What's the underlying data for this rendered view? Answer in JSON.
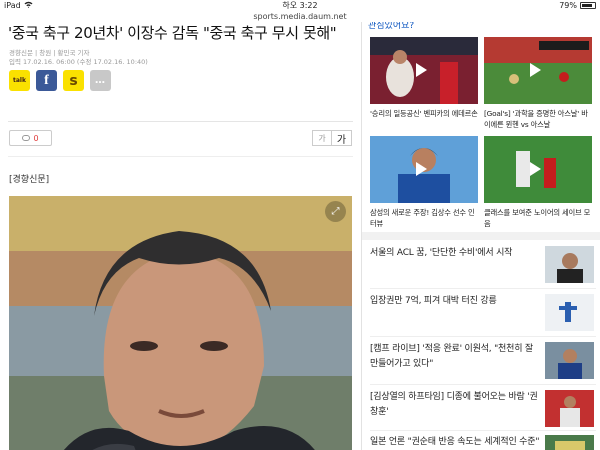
{
  "status_bar": {
    "device": "iPad",
    "time": "하오 3:22",
    "battery": "79%",
    "url": "sports.media.daum.net"
  },
  "article": {
    "headline": "'중국 축구 20년차' 이장수 감독 \"중국 축구 무시 못해\"",
    "byline": "경향신문 | 창원 | 황민국 기자",
    "dates": "입력 17.02.16. 06:00 (수정 17.02.16. 10:40)",
    "share": {
      "kakao": "talk",
      "facebook": "f",
      "story": "s",
      "more": "…"
    },
    "comment_count": "0",
    "font_small": "가",
    "font_large": "가",
    "source": "[경향신문]"
  },
  "sidebar": {
    "top_title": "관심있어요?",
    "videos": [
      {
        "caption": "'승리의 일등공신' 벤피카의 에데르손"
      },
      {
        "caption": "[Goal's] '과학을 증명한 아스날' 바이에른 뮌헨 vs 아스날"
      },
      {
        "caption": "삼성의 새로운 주장! 김상수 선수 인터뷰"
      },
      {
        "caption": "클래스를 보여준 노이어의 세이브 모음"
      }
    ],
    "news": [
      {
        "title": "서울의 ACL 꿈, '단단한 수비'에서 시작"
      },
      {
        "title": "입장권만 7억, 피겨 대박 터진 강릉"
      },
      {
        "title": "[캠프 라이브] '적응 완료' 이원석, \"천천히 잘 만들어가고 있다\""
      },
      {
        "title": "[김상열의 하프타임] 디종에 불어오는 바람 '권창훈'"
      },
      {
        "title": "일본 언론 \"권순태 반응 속도는 세계적인 수준\""
      }
    ]
  },
  "colors": {
    "accent_blue": "#0d56c0",
    "kakao_yellow": "#fae100",
    "facebook_blue": "#3b5998",
    "comment_red": "#e03b3b"
  }
}
